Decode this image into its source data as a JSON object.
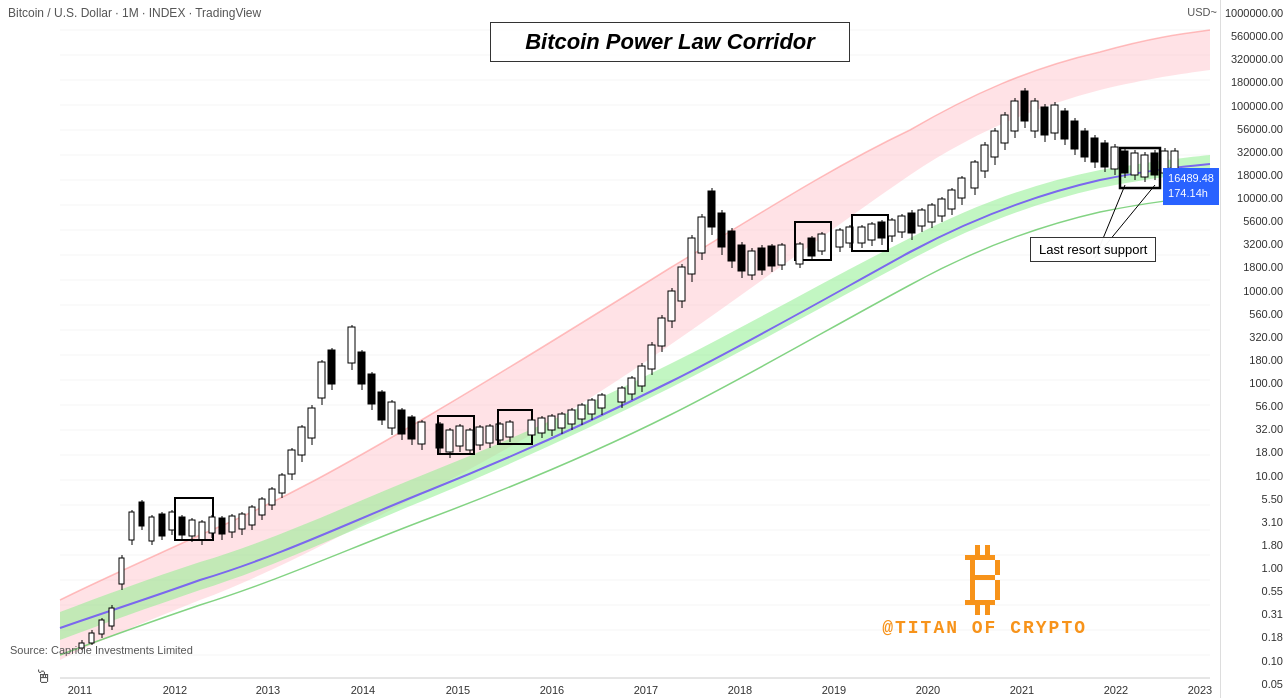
{
  "header": {
    "label": "Bitcoin / U.S. Dollar · 1M · INDEX · TradingView",
    "usd_label": "USD~"
  },
  "title": {
    "text": "Bitcoin Power Law Corridor"
  },
  "price_badge": {
    "price": "16489.48",
    "sub": "174.14h"
  },
  "annotation": {
    "last_resort": "Last resort support"
  },
  "source": {
    "text": "Source: Capriole Investments Limited"
  },
  "titan": {
    "symbol": "₿",
    "handle": "@TITAN OF CRYPTO"
  },
  "y_axis": {
    "labels": [
      "1000000.00",
      "560000.00",
      "320000.00",
      "180000.00",
      "100000.00",
      "56000.00",
      "32000.00",
      "18000.00",
      "10000.00",
      "5600.00",
      "3200.00",
      "1800.00",
      "1000.00",
      "560.00",
      "320.00",
      "180.00",
      "100.00",
      "56.00",
      "32.00",
      "18.00",
      "10.00",
      "5.50",
      "3.10",
      "1.80",
      "1.00",
      "0.55",
      "0.31",
      "0.18",
      "0.10",
      "0.05"
    ]
  },
  "x_axis": {
    "labels": [
      "2011",
      "2012",
      "2013",
      "2014",
      "2015",
      "2016",
      "2017",
      "2018",
      "2019",
      "2020",
      "2021",
      "2022",
      "2023"
    ]
  },
  "colors": {
    "pink_band": "rgba(255,182,193,0.45)",
    "green_band": "rgba(144,238,144,0.5)",
    "purple_line": "#9c27b0",
    "accent": "#f7931a",
    "candlestick_up": "#ffffff",
    "candlestick_down": "#000000"
  }
}
